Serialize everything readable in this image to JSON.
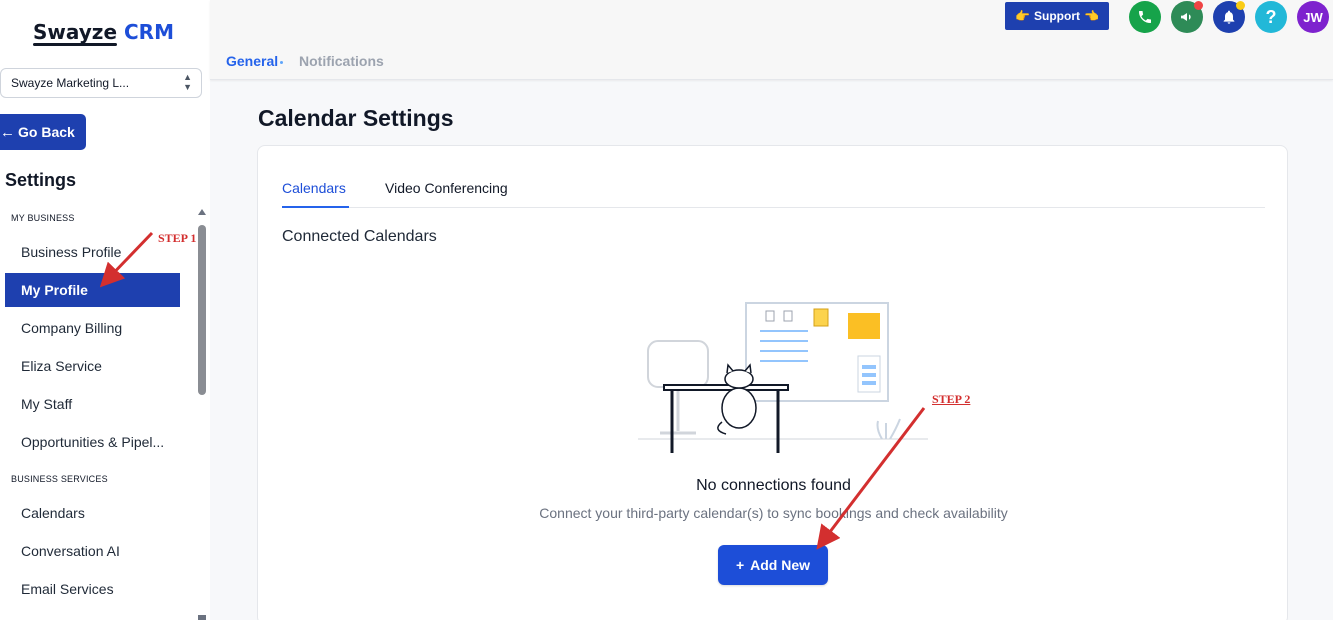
{
  "sidebar": {
    "logo_main": "Swayze",
    "logo_accent": "CRM",
    "account": "Swayze Marketing L...",
    "go_back": "Go Back",
    "title": "Settings",
    "sections": [
      {
        "label": "MY BUSINESS",
        "items": [
          "Business Profile",
          "My Profile",
          "Company Billing",
          "Eliza Service",
          "My Staff",
          "Opportunities & Pipel..."
        ]
      },
      {
        "label": "BUSINESS SERVICES",
        "items": [
          "Calendars",
          "Conversation AI",
          "Email Services"
        ]
      }
    ],
    "active_item": "My Profile"
  },
  "header": {
    "support": "Support",
    "avatar_initials": "JW",
    "tabs": [
      {
        "label": "General",
        "active": true
      },
      {
        "label": "Notifications",
        "active": false
      }
    ],
    "icons": [
      "phone-icon",
      "megaphone-icon",
      "bell-icon",
      "help-icon"
    ],
    "colors": {
      "phone": "#16a34a",
      "megaphone": "#2e8b57",
      "bell": "#1e40af",
      "help": "#22b8d8",
      "avatar": "#7e22ce",
      "dot_red": "#ef4444",
      "dot_yellow": "#facc15"
    }
  },
  "main": {
    "title": "Calendar Settings",
    "tabs": [
      {
        "label": "Calendars",
        "active": true
      },
      {
        "label": "Video Conferencing",
        "active": false
      }
    ],
    "section_title": "Connected Calendars",
    "empty_title": "No connections found",
    "empty_subtitle": "Connect your third-party calendar(s) to sync bookings and check availability",
    "add_button": "Add New"
  },
  "annotations": {
    "step1": "STEP 1",
    "step2": "STEP 2",
    "color": "#d32f2f"
  }
}
